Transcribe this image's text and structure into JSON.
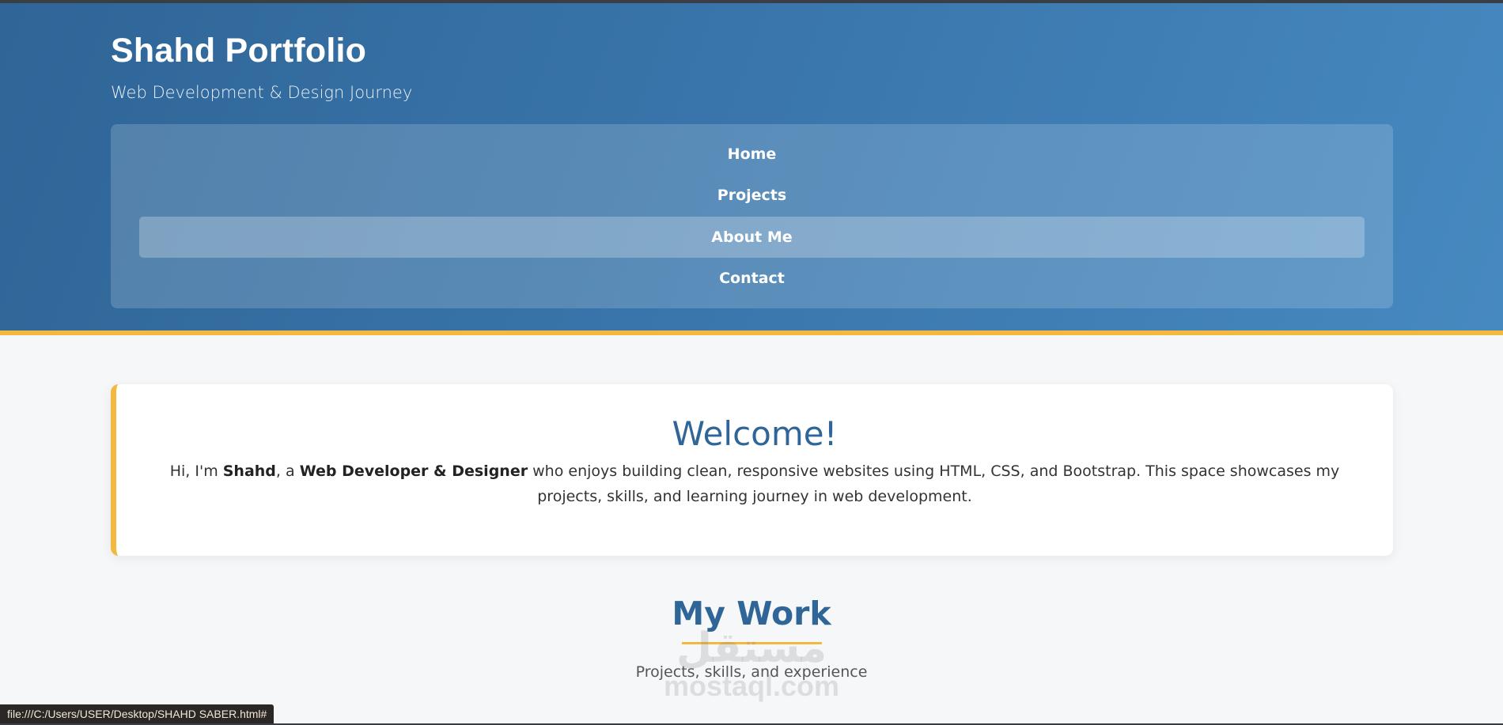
{
  "header": {
    "title": "Shahd Portfolio",
    "subtitle": "Web Development & Design Journey"
  },
  "nav": {
    "items": [
      {
        "label": "Home",
        "active": false
      },
      {
        "label": "Projects",
        "active": false
      },
      {
        "label": "About Me",
        "active": true
      },
      {
        "label": "Contact",
        "active": false
      }
    ]
  },
  "welcome": {
    "title": "Welcome!",
    "text_intro": "Hi, I'm ",
    "name": "Shahd",
    "text_sep": ", a ",
    "role": "Web Developer & Designer",
    "text_rest": " who enjoys building clean, responsive websites using HTML, CSS, and Bootstrap. This space showcases my projects, skills, and learning journey in web development."
  },
  "work": {
    "title": "My Work",
    "subtitle": "Projects, skills, and experience"
  },
  "watermark": {
    "arabic": "مستقل",
    "domain": "mostaql.com"
  },
  "status_bar": {
    "url": "file:///C:/Users/USER/Desktop/SHAHD SABER.html#"
  },
  "colors": {
    "header_start": "#2f6597",
    "header_end": "#4689c0",
    "accent": "#f2b83f",
    "heading": "#2f6597"
  }
}
